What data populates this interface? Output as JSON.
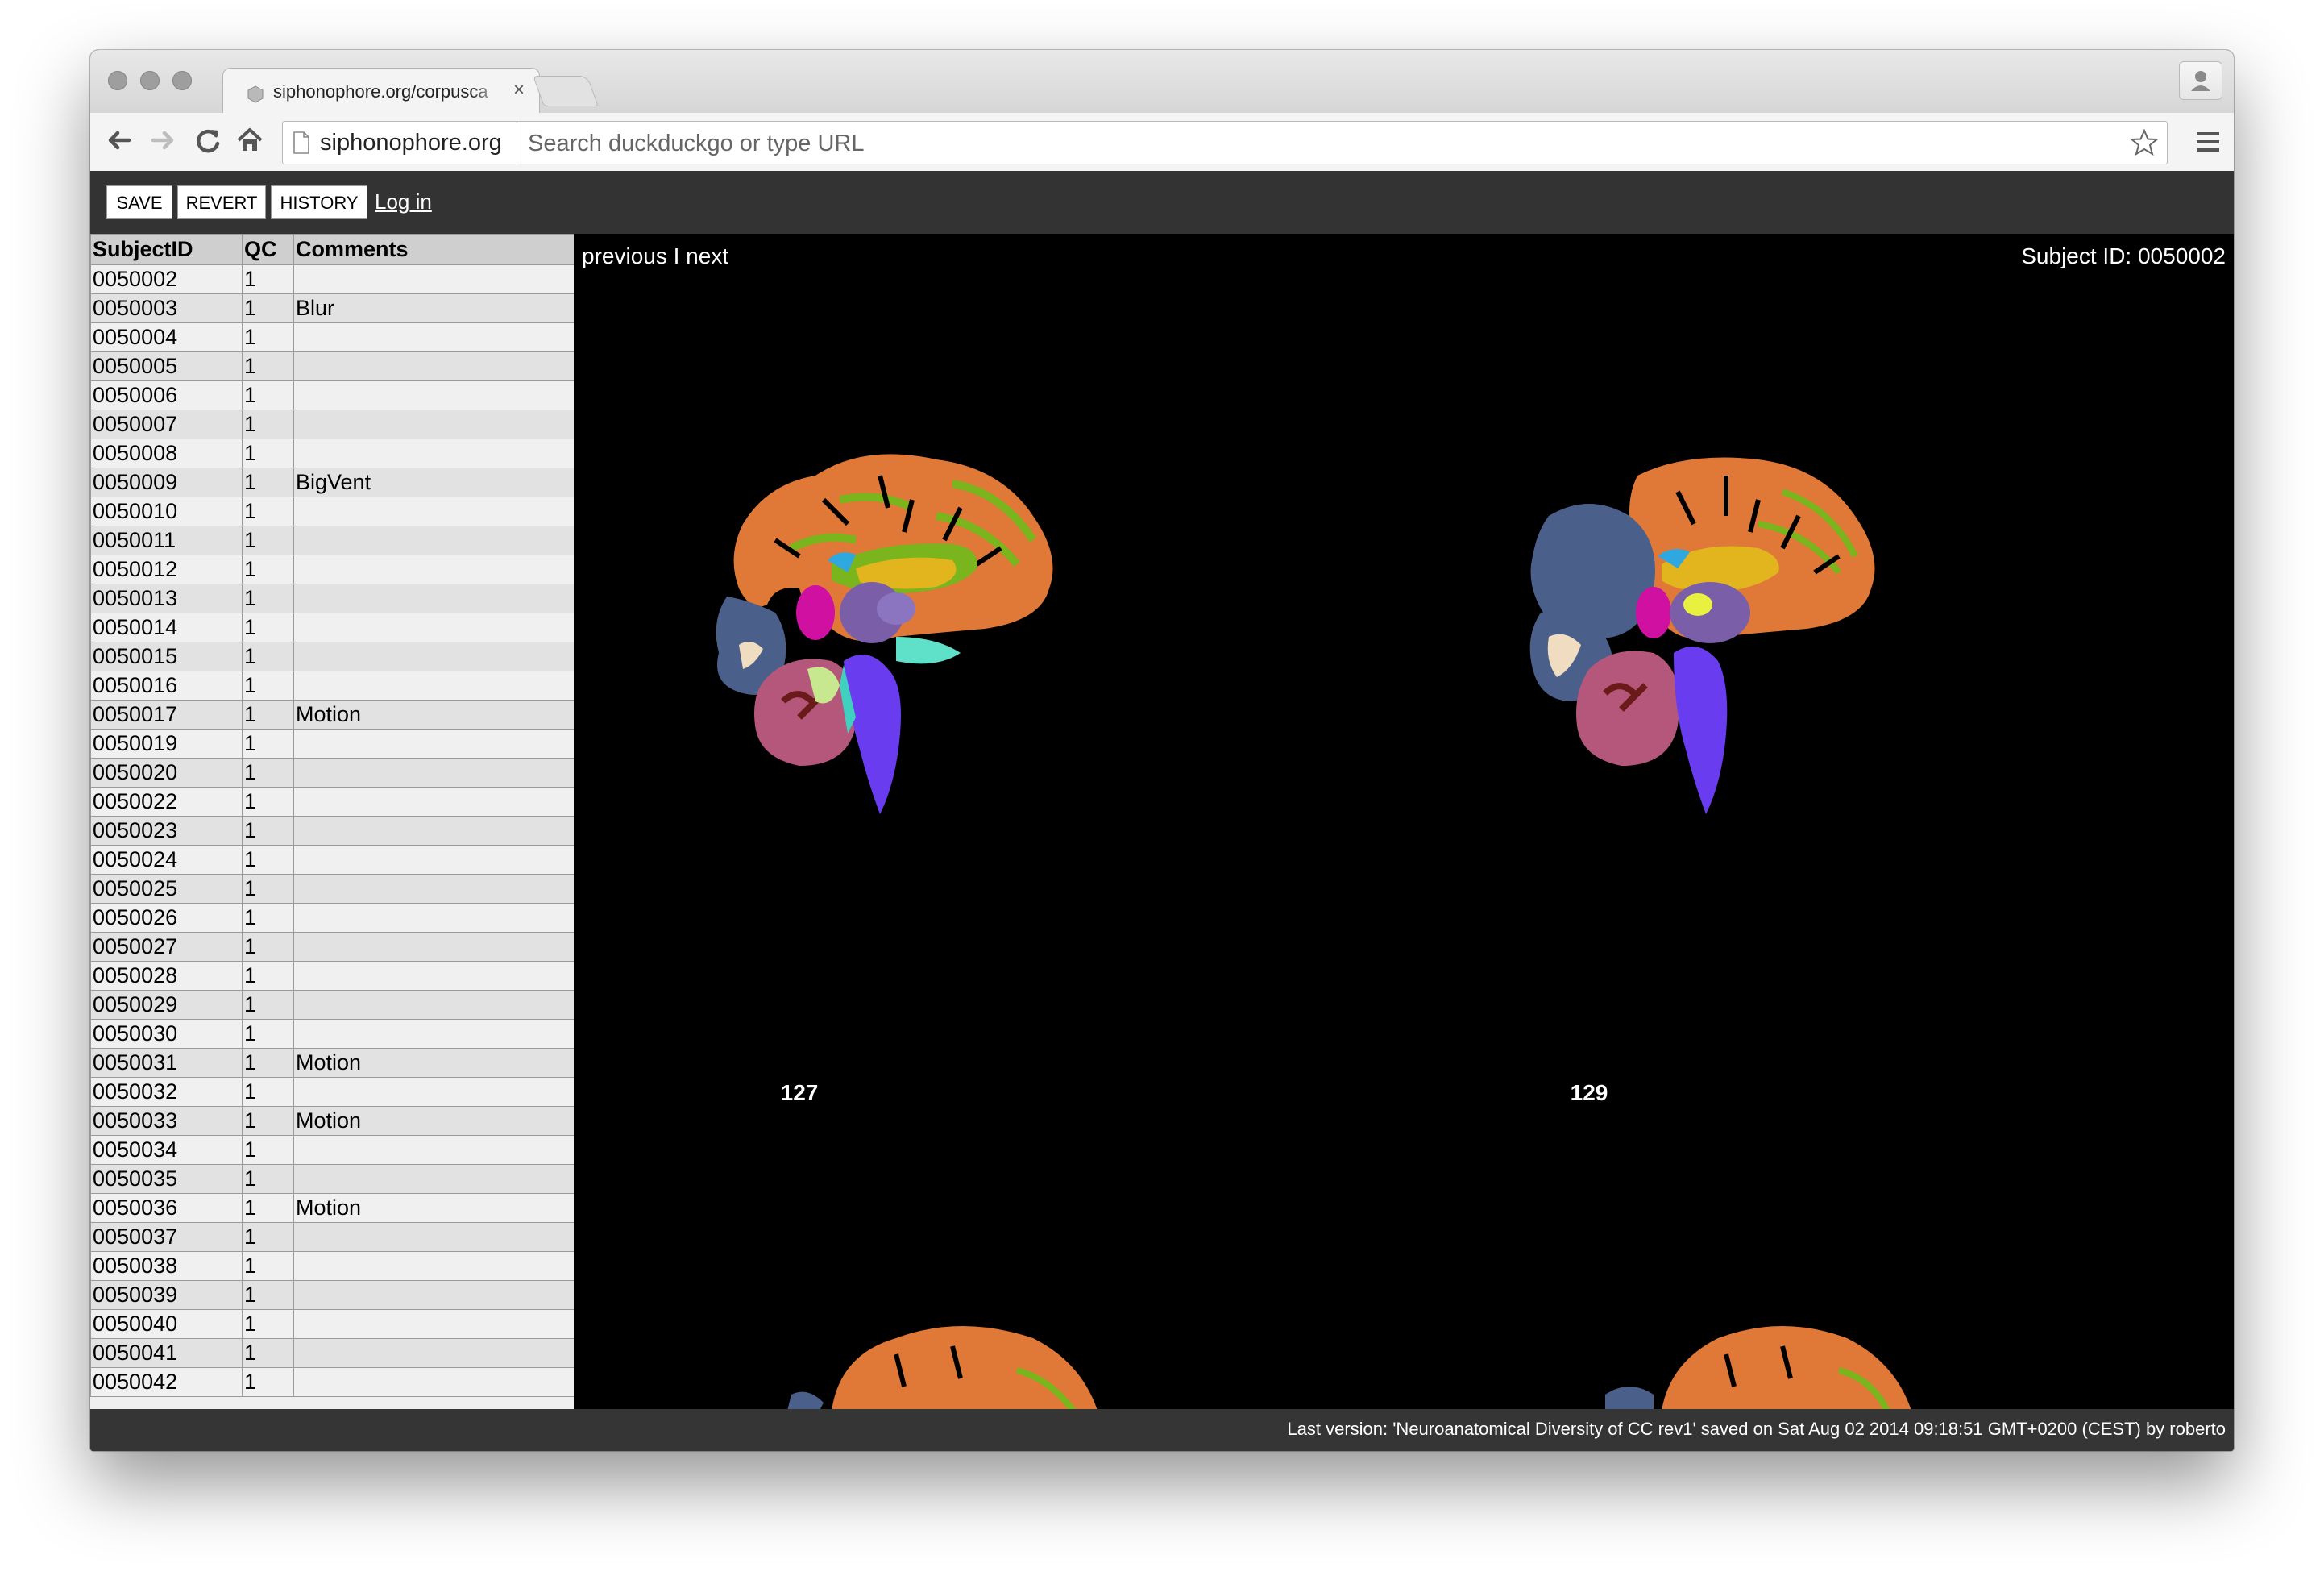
{
  "browser": {
    "tab_title": "siphonophore.org/corpusca",
    "tab_close": "×",
    "omnibox_host": "siphonophore.org",
    "omnibox_placeholder": "Search duckduckgo or type URL"
  },
  "app": {
    "buttons": {
      "save": "SAVE",
      "revert": "REVERT",
      "history": "HISTORY"
    },
    "login_link": "Log in",
    "table": {
      "headers": [
        "SubjectID",
        "QC",
        "Comments"
      ],
      "rows": [
        [
          "0050002",
          "1",
          ""
        ],
        [
          "0050003",
          "1",
          "Blur"
        ],
        [
          "0050004",
          "1",
          ""
        ],
        [
          "0050005",
          "1",
          ""
        ],
        [
          "0050006",
          "1",
          ""
        ],
        [
          "0050007",
          "1",
          ""
        ],
        [
          "0050008",
          "1",
          ""
        ],
        [
          "0050009",
          "1",
          "BigVent"
        ],
        [
          "0050010",
          "1",
          ""
        ],
        [
          "0050011",
          "1",
          ""
        ],
        [
          "0050012",
          "1",
          ""
        ],
        [
          "0050013",
          "1",
          ""
        ],
        [
          "0050014",
          "1",
          ""
        ],
        [
          "0050015",
          "1",
          ""
        ],
        [
          "0050016",
          "1",
          ""
        ],
        [
          "0050017",
          "1",
          "Motion"
        ],
        [
          "0050019",
          "1",
          ""
        ],
        [
          "0050020",
          "1",
          ""
        ],
        [
          "0050022",
          "1",
          ""
        ],
        [
          "0050023",
          "1",
          ""
        ],
        [
          "0050024",
          "1",
          ""
        ],
        [
          "0050025",
          "1",
          ""
        ],
        [
          "0050026",
          "1",
          ""
        ],
        [
          "0050027",
          "1",
          ""
        ],
        [
          "0050028",
          "1",
          ""
        ],
        [
          "0050029",
          "1",
          ""
        ],
        [
          "0050030",
          "1",
          ""
        ],
        [
          "0050031",
          "1",
          "Motion"
        ],
        [
          "0050032",
          "1",
          ""
        ],
        [
          "0050033",
          "1",
          "Motion"
        ],
        [
          "0050034",
          "1",
          ""
        ],
        [
          "0050035",
          "1",
          ""
        ],
        [
          "0050036",
          "1",
          "Motion"
        ],
        [
          "0050037",
          "1",
          ""
        ],
        [
          "0050038",
          "1",
          ""
        ],
        [
          "0050039",
          "1",
          ""
        ],
        [
          "0050040",
          "1",
          ""
        ],
        [
          "0050041",
          "1",
          ""
        ],
        [
          "0050042",
          "1",
          ""
        ]
      ]
    },
    "viewer": {
      "pager": "previous I next",
      "subject_label": "Subject ID: 0050002",
      "slices": [
        "127",
        "129"
      ]
    },
    "status": "Last version: 'Neuroanatomical Diversity of CC rev1' saved on Sat Aug 02 2014 09:18:51 GMT+0200 (CEST) by roberto"
  },
  "colors": {
    "cortex": "#e07838",
    "white_matter": "#7ab51d",
    "cerebellum": "#b5577a",
    "brainstem": "#6a3cf0",
    "occipital": "#4a5f8a",
    "thalamus": "#7a5fa8",
    "caudate": "#d010a0",
    "ventricle": "#e2b41e",
    "cc": "#2fa8e0",
    "app_bar": "#333333"
  },
  "icons": [
    "back-icon",
    "forward-icon",
    "reload-icon",
    "home-icon",
    "page-icon",
    "star-icon",
    "menu-icon",
    "close-icon",
    "profile-icon"
  ]
}
